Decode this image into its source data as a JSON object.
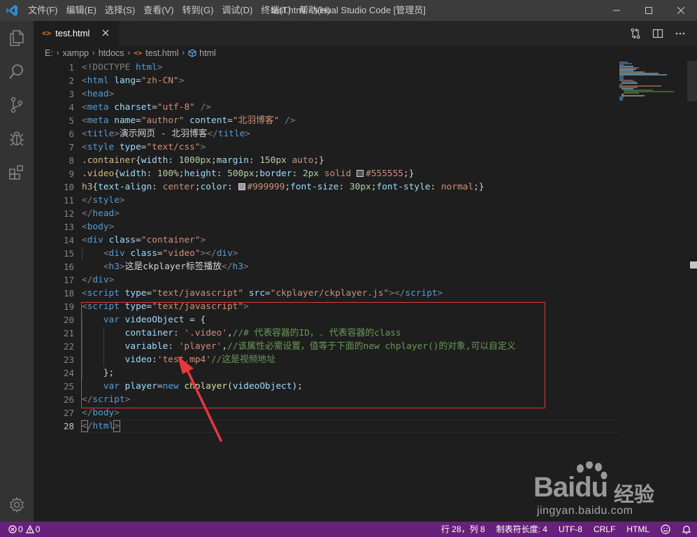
{
  "window": {
    "title": "test.html - Visual Studio Code [管理员]"
  },
  "menu": [
    "文件(F)",
    "编辑(E)",
    "选择(S)",
    "查看(V)",
    "转到(G)",
    "调试(D)",
    "终端(T)",
    "帮助(H)"
  ],
  "activity_bar": [
    "files-icon",
    "search-icon",
    "source-control-icon",
    "debug-icon",
    "extensions-icon",
    "gear-icon"
  ],
  "tab": {
    "icon": "<>",
    "label": "test.html"
  },
  "breadcrumb": {
    "items": [
      "E:",
      "xampp",
      "htdocs",
      "test.html",
      "html"
    ]
  },
  "editor": {
    "line_numbers": [
      "1",
      "2",
      "3",
      "4",
      "5",
      "6",
      "7",
      "8",
      "9",
      "10",
      "11",
      "12",
      "13",
      "14",
      "15",
      "16",
      "17",
      "18",
      "19",
      "20",
      "21",
      "22",
      "23",
      "24",
      "25",
      "26",
      "27",
      "28"
    ],
    "active_line": 28,
    "code": {
      "l1_a": "<!DOCTYPE ",
      "l1_b": "html",
      "l1_c": ">",
      "l2_tag": "html",
      "l2_attr": "lang",
      "l2_val": "\"zh-CN\"",
      "l3_tag": "head",
      "l4_tag": "meta",
      "l4_attr": "charset",
      "l4_val": "\"utf-8\"",
      "l4_end": " />",
      "l5_tag": "meta",
      "l5_attr1": "name",
      "l5_val1": "\"author\"",
      "l5_attr2": "content",
      "l5_val2": "\"北羽博客\"",
      "l5_end": " />",
      "l6_tag": "title",
      "l6_text": "演示网页 - 北羽博客",
      "l6_close": "title",
      "l7_tag": "style",
      "l7_attr": "type",
      "l7_val": "\"text/css\"",
      "l8_sel": ".container",
      "l8_p1": "width",
      "l8_v1": "1000px",
      "l8_p2": "margin",
      "l8_v2": "150px",
      "l8_v3": "auto",
      "l9_sel": ".video",
      "l9_p1": "width",
      "l9_v1": "100%",
      "l9_p2": "height",
      "l9_v2": "500px",
      "l9_p3": "border",
      "l9_v3": "2px",
      "l9_v4": "solid",
      "l9_color": "#555555",
      "l10_sel": "h3",
      "l10_p1": "text-align",
      "l10_v1": "center",
      "l10_p2": "color",
      "l10_color": "#999999",
      "l10_p3": "font-size",
      "l10_v3": "30px",
      "l10_p4": "font-style",
      "l10_v4": "normal",
      "l11_tag": "style",
      "l12_tag": "head",
      "l13_tag": "body",
      "l14_tag": "div",
      "l14_attr": "class",
      "l14_val": "\"container\"",
      "l15_tag": "div",
      "l15_attr": "class",
      "l15_val": "\"video\"",
      "l15_close": "div",
      "l16_tag": "h3",
      "l16_text": "这是ckplayer标签播放",
      "l16_close": "h3",
      "l17_tag": "div",
      "l18_tag": "script",
      "l18_attr1": "type",
      "l18_val1": "\"text/javascript\"",
      "l18_attr2": "src",
      "l18_val2": "\"ckplayer/ckplayer.js\"",
      "l18_close": "script",
      "l19_tag": "script",
      "l19_attr": "type",
      "l19_val": "\"text/javascript\"",
      "l20_kw": "var",
      "l20_id": "videoObject",
      "l20_rest": " = {",
      "l21_key": "container",
      "l21_val": "'.video'",
      "l21_cm": "//# 代表容器的ID，. 代表容器的class",
      "l22_key": "variable",
      "l22_val": "'player'",
      "l22_cm": "//该属性必需设置，值等于下面的new chplayer()的对象,可以自定义",
      "l23_key": "video",
      "l23_val": "'test.mp4'",
      "l23_cm": "//这是视频地址",
      "l24_text": "};",
      "l25_kw": "var",
      "l25_id": "player",
      "l25_kw2": "new",
      "l25_fn": "chplayer",
      "l25_arg": "videoObject",
      "l26_tag": "script",
      "l27_tag": "body",
      "l28_tag": "html"
    }
  },
  "watermark": {
    "brand": "Baidu",
    "suffix": "经验",
    "url": "jingyan.baidu.com"
  },
  "status_bar": {
    "errors": "0",
    "warnings": "0",
    "position": "行 28，列 8",
    "tab_size": "制表符长度: 4",
    "encoding": "UTF-8",
    "eol": "CRLF",
    "language": "HTML"
  },
  "colors": {
    "status_bar": "#68217a",
    "highlight_box": "#e0383e",
    "arrow": "#e8383d"
  }
}
